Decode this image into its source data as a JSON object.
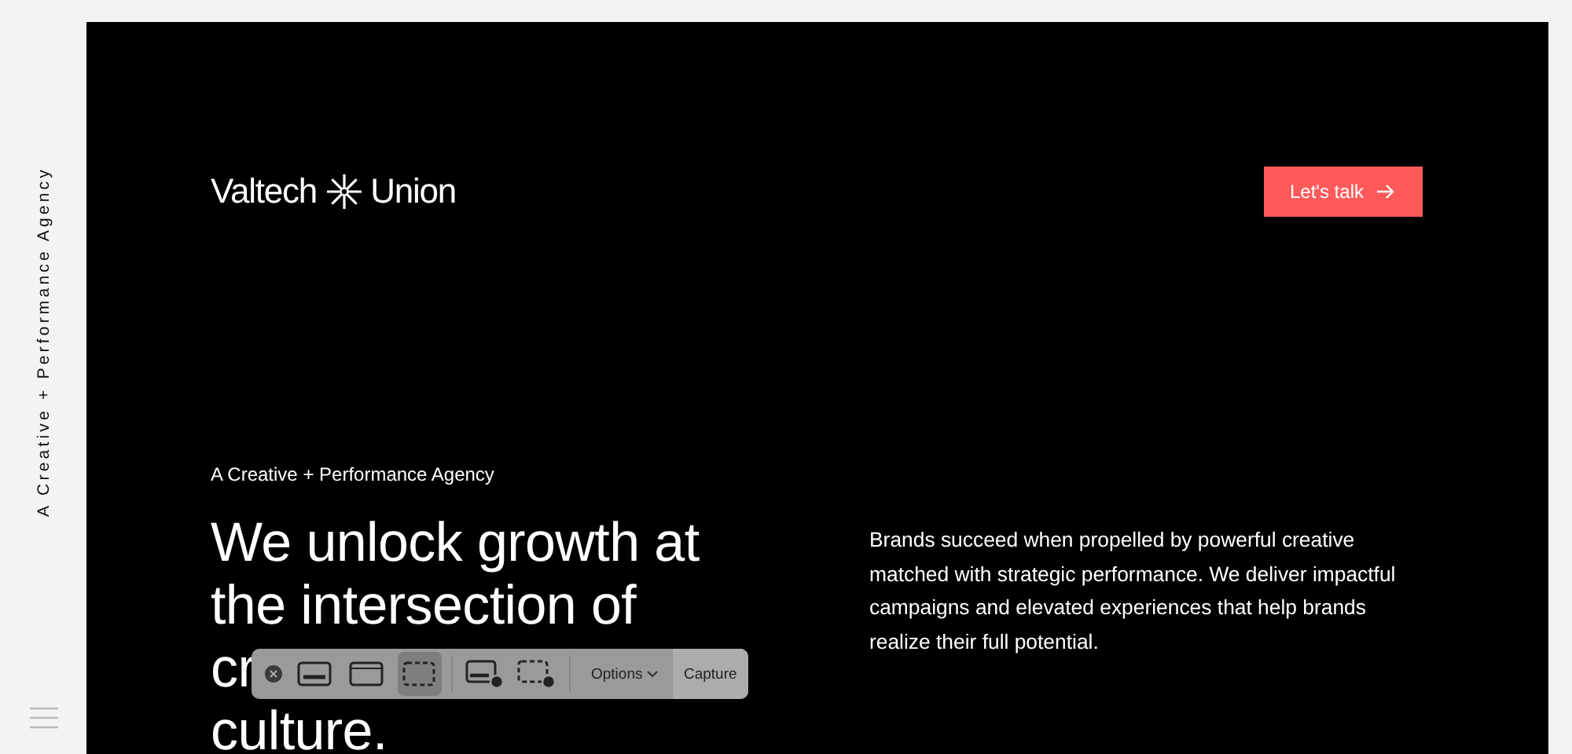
{
  "sidebar": {
    "tagline": "A Creative + Performance Agency"
  },
  "header": {
    "logo": [
      "Valtech",
      "Union"
    ],
    "cta": "Let's talk"
  },
  "hero": {
    "eyebrow": "A Creative + Performance Agency",
    "headline_lines": [
      "We unlock growth at",
      "the intersection of",
      "cr",
      "culture."
    ],
    "body": "Brands succeed when propelled by powerful creative matched with strategic performance. We deliver impactful campaigns and elevated experiences that help brands realize their full potential."
  },
  "capture_toolbar": {
    "tools": [
      {
        "kind": "screen",
        "selected": false
      },
      {
        "kind": "window",
        "selected": false
      },
      {
        "kind": "selection",
        "selected": true
      },
      {
        "kind": "record-screen",
        "selected": false
      },
      {
        "kind": "record-selection",
        "selected": false
      }
    ],
    "options": "Options",
    "capture": "Capture"
  }
}
